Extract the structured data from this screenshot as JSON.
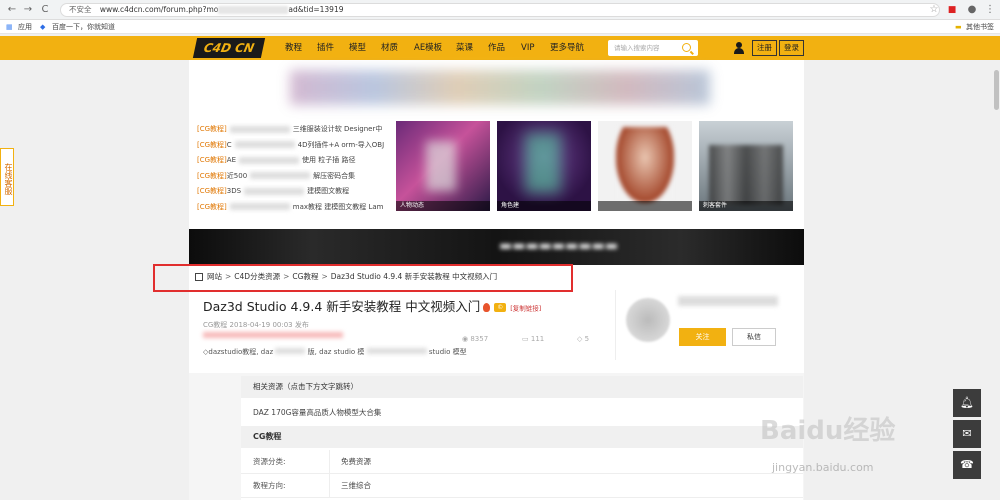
{
  "browser": {
    "back": "←",
    "forward": "→",
    "reload": "C",
    "home": "⌂",
    "security": "不安全",
    "url_start": "www.c4dcn.com/forum.php?mo",
    "url_end": "ad&tid=13919",
    "bookmarks": [
      "应用",
      "百度一下，你就知道"
    ],
    "other_bookmarks": "其他书签"
  },
  "header": {
    "logo_text": "C4D CN",
    "nav": [
      "教程",
      "插件",
      "模型",
      "材质",
      "AE模板",
      "菜课",
      "作品",
      "VIP",
      "更多导航"
    ],
    "search_placeholder": "请输入搜索内容",
    "register": "注册",
    "login": "登录"
  },
  "sidebar": {
    "online_service": "在线客服"
  },
  "news": [
    {
      "tag": "[CG教程]",
      "text_start": "",
      "text_end": "三维服装设计软 Designer中"
    },
    {
      "tag": "[CG教程]",
      "text_start": "C",
      "text_end": "4D列插件+A orm-导入OBJ"
    },
    {
      "tag": "[CG教程]",
      "text_start": "AE",
      "text_end": "使用 粒子插 路径"
    },
    {
      "tag": "[CG教程]",
      "text_start": "近500",
      "text_end": "解压密码合集"
    },
    {
      "tag": "[CG教程]",
      "text_start": "3DS",
      "text_end": "建模图文教程"
    },
    {
      "tag": "[CG教程]",
      "text_start": "",
      "text_end": "max教程 建模图文教程 Lam"
    }
  ],
  "thumbs": [
    "人物动态",
    "角色建",
    "",
    "刺客套件"
  ],
  "breadcrumb": {
    "items": [
      "网站",
      "C4D分类资源",
      "CG教程",
      "Daz3d Studio 4.9.4 新手安装教程 中文视频入门"
    ],
    "separator": ">"
  },
  "article": {
    "title": "Daz3d Studio 4.9.4 新手安装教程 中文视频入门",
    "copy_link": "[复制链接]",
    "meta": "CG教程 2018-04-19 00:03 发布",
    "views": "8357",
    "comments": "111",
    "likes": "5",
    "tags_start": "dazstudio教程, daz",
    "tags_mid": "版, daz studio 模",
    "tags_end": "studio 模型"
  },
  "author": {
    "follow": "关注",
    "message": "私信"
  },
  "resources": {
    "head": "相关资源（点击下方文字跳转）",
    "item": "DAZ 170G容量高品质人物模型大合集"
  },
  "cg": {
    "head": "CG教程",
    "rows": [
      {
        "key": "资源分类:",
        "value": "免费资源"
      },
      {
        "key": "教程方向:",
        "value": "三维综合"
      }
    ]
  },
  "watermark": {
    "brand": "Baidu经验",
    "domain": "jingyan.baidu.com"
  },
  "colors": {
    "accent": "#f2b111",
    "highlight_frame": "#e12e2e",
    "tag": "#e07600"
  }
}
